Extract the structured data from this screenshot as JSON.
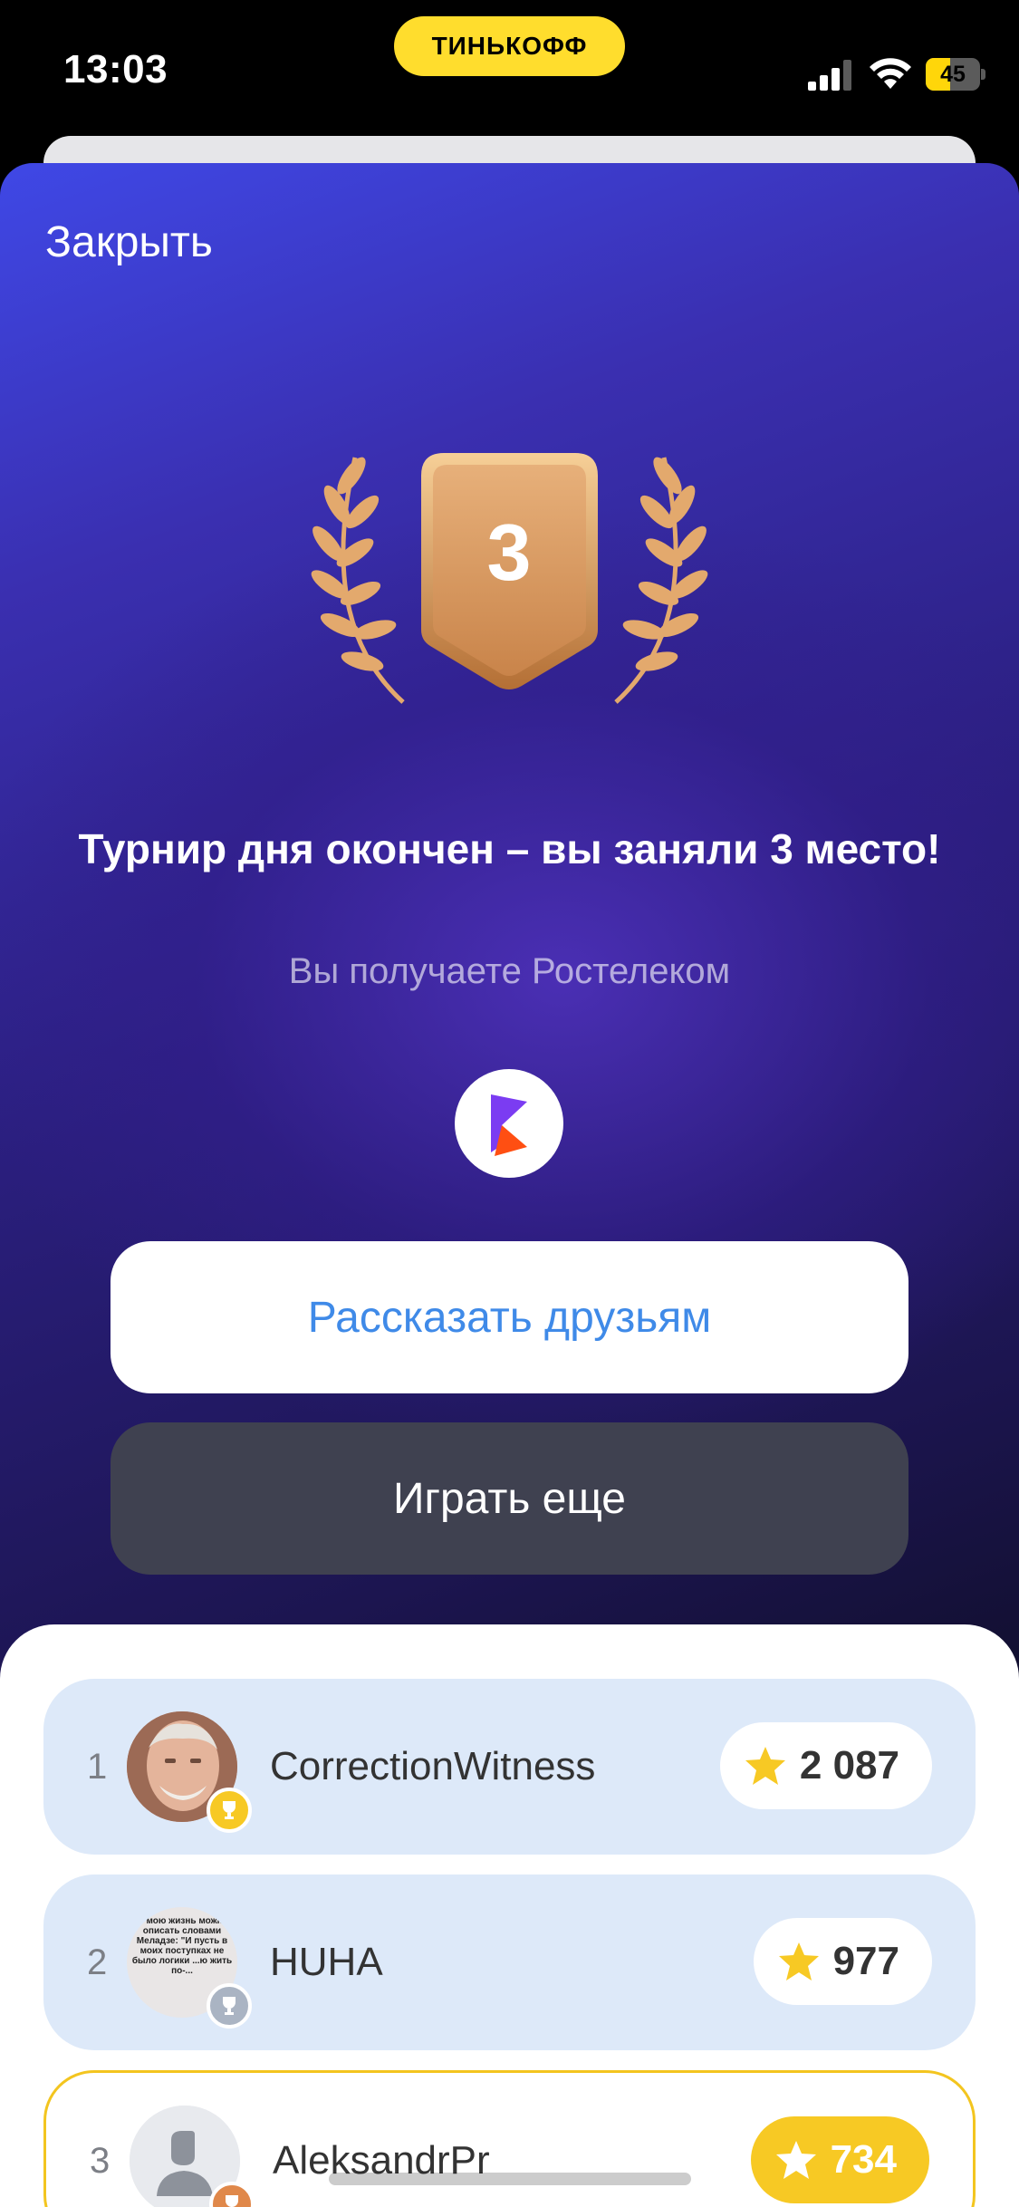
{
  "status_bar": {
    "time": "13:03",
    "carrier": "ТИНЬКОФФ",
    "battery_level": 45,
    "battery_label": "45"
  },
  "modal": {
    "close_label": "Закрыть",
    "place_number": "3",
    "title": "Турнир дня окончен – вы заняли 3 место!",
    "prize_text": "Вы получаете Ростелеком",
    "prize_logo_icon": "rostelecom-logo-icon",
    "share_button_label": "Рассказать друзьям",
    "play_button_label": "Играть еще"
  },
  "leaderboard": {
    "rows": [
      {
        "rank": "1",
        "name": "CorrectionWitness",
        "score": "2 087",
        "badge": "gold-trophy-icon",
        "is_me": false
      },
      {
        "rank": "2",
        "name": "HUHA",
        "score": "977",
        "badge": "silver-trophy-icon",
        "is_me": false
      },
      {
        "rank": "3",
        "name": "AleksandrPr",
        "score": "734",
        "badge": "bronze-trophy-icon",
        "is_me": true
      }
    ],
    "meme_avatar_text": "ю мою жизнь можно описать словами Меладзе: \"И пусть в моих поступках не было логики ...ю жить по-..."
  },
  "colors": {
    "brand_yellow": "#ffdd2d",
    "accent_blue": "#3f8ae8",
    "bronze": "#d9955a",
    "row_bg": "#dde9f9",
    "score_gold": "#f7c924"
  }
}
